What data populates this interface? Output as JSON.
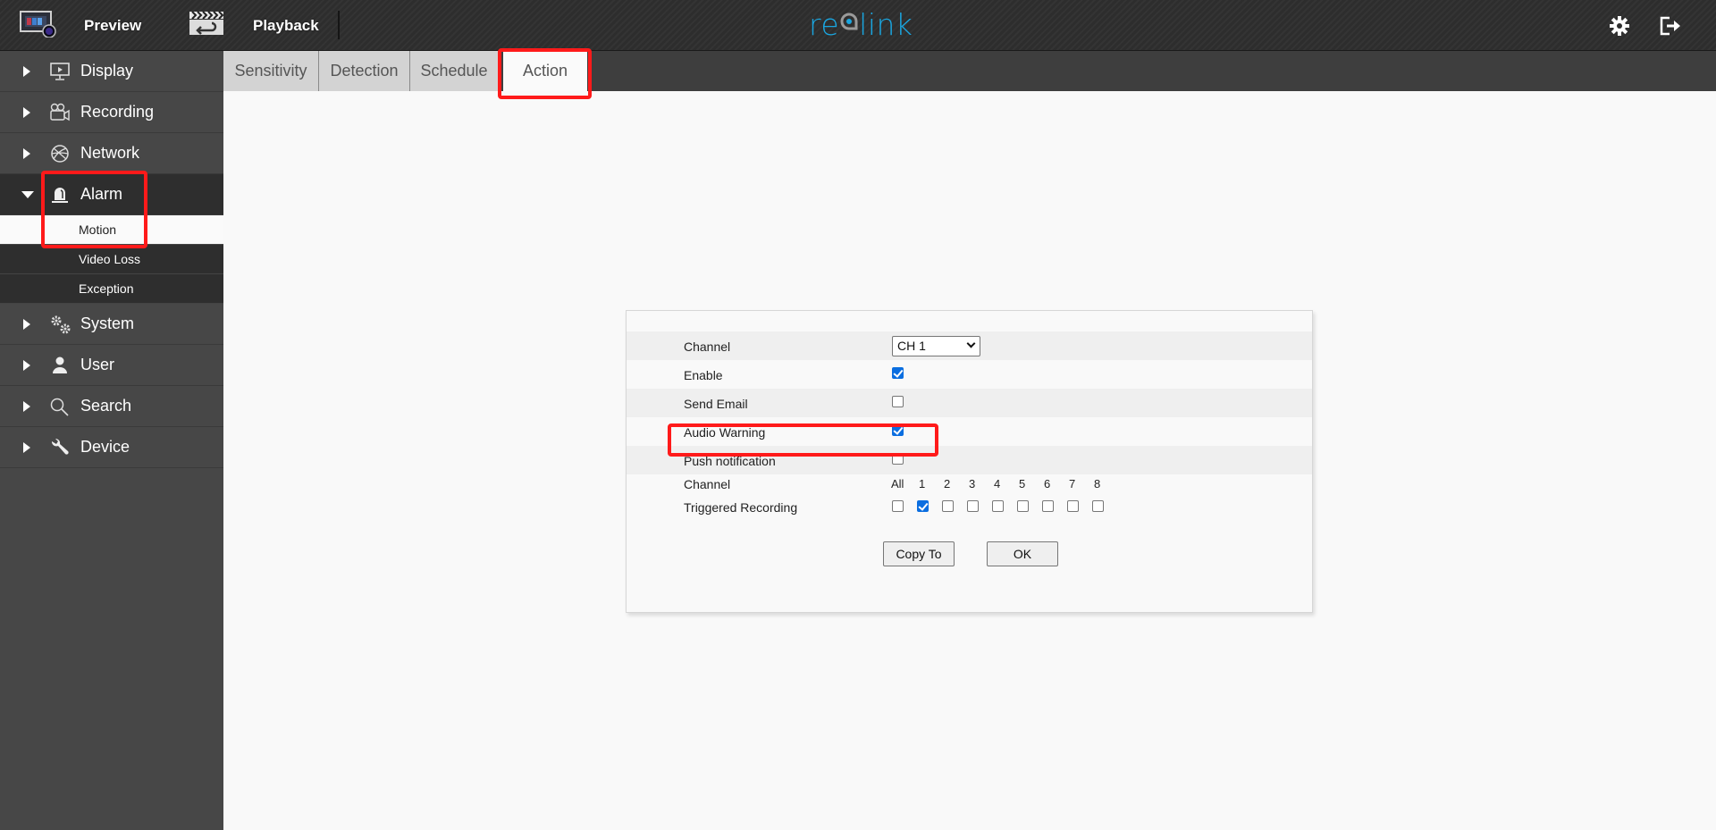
{
  "header": {
    "nav": [
      {
        "label": "Preview",
        "icon": "preview-monitor-icon"
      },
      {
        "label": "Playback",
        "icon": "playback-clapper-icon"
      }
    ],
    "logo": {
      "part1": "re",
      "part2": "o",
      "part3": "link"
    },
    "actions": [
      {
        "name": "settings",
        "icon": "gear-icon"
      },
      {
        "name": "logout",
        "icon": "logout-icon"
      }
    ]
  },
  "sidebar": {
    "items": [
      {
        "label": "Display",
        "icon": "monitor-icon",
        "expanded": false
      },
      {
        "label": "Recording",
        "icon": "video-camera-icon",
        "expanded": false
      },
      {
        "label": "Network",
        "icon": "network-globe-icon",
        "expanded": false
      },
      {
        "label": "Alarm",
        "icon": "alarm-siren-icon",
        "expanded": true,
        "children": [
          {
            "label": "Motion",
            "selected": true
          },
          {
            "label": "Video Loss",
            "selected": false
          },
          {
            "label": "Exception",
            "selected": false
          }
        ]
      },
      {
        "label": "System",
        "icon": "gears-icon",
        "expanded": false
      },
      {
        "label": "User",
        "icon": "user-icon",
        "expanded": false
      },
      {
        "label": "Search",
        "icon": "search-icon",
        "expanded": false
      },
      {
        "label": "Device",
        "icon": "wrench-icon",
        "expanded": false
      }
    ]
  },
  "tabs": [
    {
      "label": "Sensitivity",
      "active": false
    },
    {
      "label": "Detection",
      "active": false
    },
    {
      "label": "Schedule",
      "active": false
    },
    {
      "label": "Action",
      "active": true
    }
  ],
  "form": {
    "channel": {
      "label": "Channel",
      "value": "CH 1"
    },
    "enable": {
      "label": "Enable",
      "checked": true
    },
    "send_email": {
      "label": "Send Email",
      "checked": false
    },
    "audio_warning": {
      "label": "Audio Warning",
      "checked": true
    },
    "push_notification": {
      "label": "Push notification",
      "checked": false
    },
    "triggered_recording": {
      "channel_header_label": "Channel",
      "label": "Triggered Recording",
      "channels": [
        {
          "label": "All",
          "checked": false
        },
        {
          "label": "1",
          "checked": true
        },
        {
          "label": "2",
          "checked": false
        },
        {
          "label": "3",
          "checked": false
        },
        {
          "label": "4",
          "checked": false
        },
        {
          "label": "5",
          "checked": false
        },
        {
          "label": "6",
          "checked": false
        },
        {
          "label": "7",
          "checked": false
        },
        {
          "label": "8",
          "checked": false
        }
      ]
    },
    "buttons": {
      "copy_to": "Copy To",
      "ok": "OK"
    }
  },
  "annotations": {
    "color": "#ff1a1a",
    "highlighted": [
      "Action tab",
      "Alarm > Motion",
      "Audio Warning"
    ]
  },
  "colors": {
    "brand": "#1aa6e0",
    "checkbox_checked": "#0b6ee0"
  }
}
